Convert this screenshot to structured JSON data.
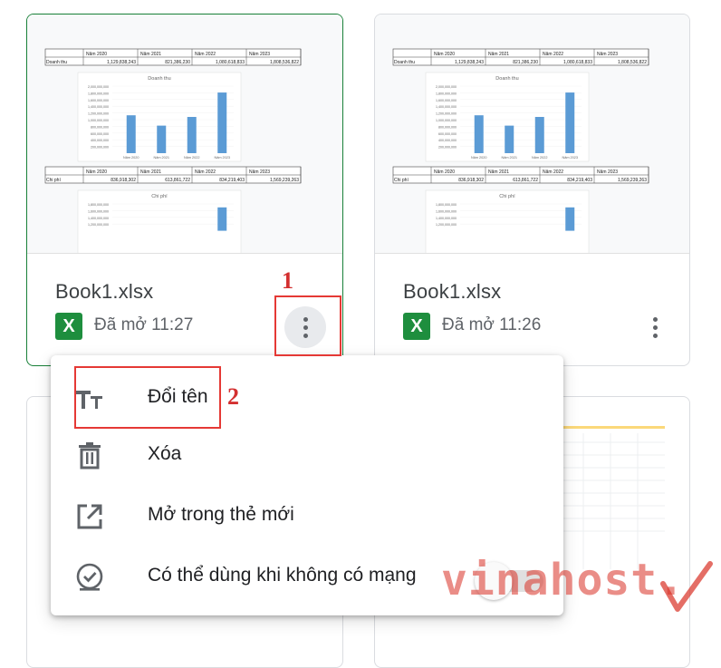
{
  "files": [
    {
      "title": "Book1.xlsx",
      "file_type": "X",
      "opened": "Đã mở 11:27"
    },
    {
      "title": "Book1.xlsx",
      "file_type": "X",
      "opened": "Đã mở 11:26"
    }
  ],
  "thumbnail": {
    "header_years": [
      "Năm 2020",
      "Năm 2021",
      "Năm 2022",
      "Năm 2023"
    ],
    "revenue_label": "Doanh thu",
    "revenue_values": [
      "1,129,838,243",
      "821,386,230",
      "1,080,618,833",
      "1,808,536,822"
    ],
    "cost_label": "Chi phí",
    "cost_values": [
      "836,918,302",
      "613,861,722",
      "834,219,403",
      "1,569,239,263"
    ],
    "chart1_title": "Doanh thu",
    "chart1_yticks": [
      "2,000,000,000",
      "1,800,000,000",
      "1,600,000,000",
      "1,400,000,000",
      "1,200,000,000",
      "1,000,000,000",
      "800,000,000",
      "600,000,000",
      "400,000,000",
      "200,000,000"
    ],
    "chart2_title": "Chi phí",
    "chart2_yticks": [
      "1,800,000,000",
      "1,600,000,000",
      "1,400,000,000",
      "1,200,000,000"
    ]
  },
  "menu": {
    "items": [
      {
        "label": "Đổi tên",
        "icon": "rename-icon"
      },
      {
        "label": "Xóa",
        "icon": "trash-icon"
      },
      {
        "label": "Mở trong thẻ mới",
        "icon": "open-new-tab-icon"
      },
      {
        "label": "Có thể dùng khi không có mạng",
        "icon": "offline-check-icon"
      }
    ],
    "offline_toggle": "off"
  },
  "annotations": {
    "step1": "1",
    "step2": "2"
  },
  "watermark": {
    "text": "vinahost."
  },
  "colors": {
    "accent_green": "#188038",
    "excel_green": "#1e8e3e",
    "annotation_red": "#e53935",
    "bar_blue": "#5b9bd5"
  }
}
